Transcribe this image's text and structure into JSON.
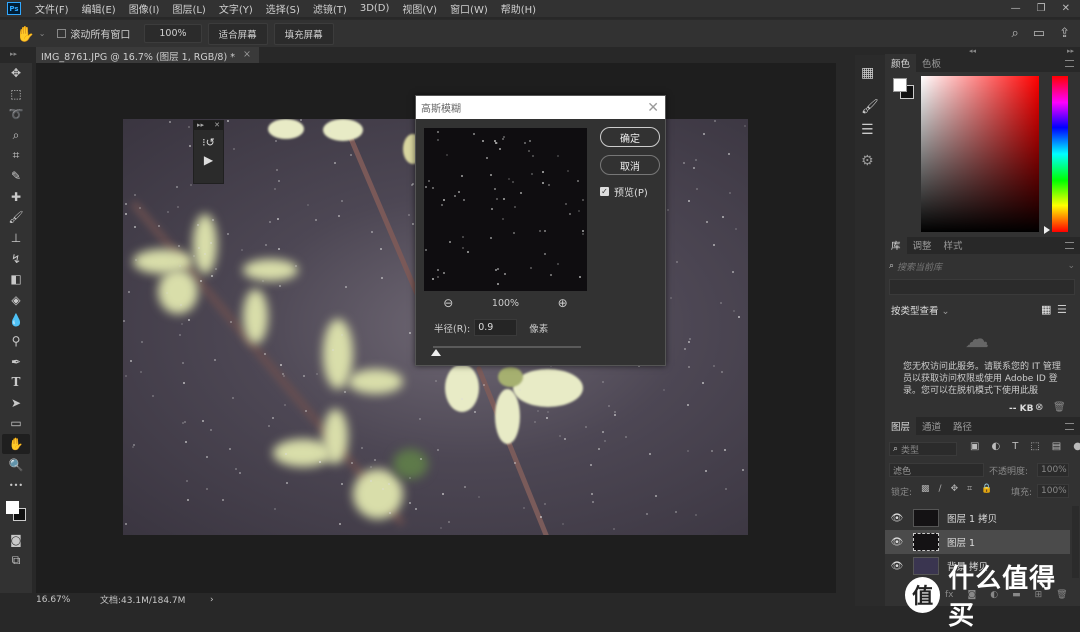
{
  "app": {
    "logo": "Ps"
  },
  "menu": [
    "文件(F)",
    "编辑(E)",
    "图像(I)",
    "图层(L)",
    "文字(Y)",
    "选择(S)",
    "滤镜(T)",
    "3D(D)",
    "视图(V)",
    "窗口(W)",
    "帮助(H)"
  ],
  "window_controls": {
    "minimize": "—",
    "restore": "❐",
    "close": "✕"
  },
  "options_bar": {
    "tool_icon": "hand-icon",
    "scroll_all_label": "滚动所有窗口",
    "scroll_all_checked": false,
    "zoom_value": "100%",
    "fit_screen": "适合屏幕",
    "fill_screen": "填充屏幕"
  },
  "document": {
    "tab_title": "IMG_8761.JPG @ 16.7% (图层 1, RGB/8) *",
    "tab_close": "×"
  },
  "tools": [
    {
      "name": "move",
      "glyph": "✥"
    },
    {
      "name": "marquee",
      "glyph": "⬚"
    },
    {
      "name": "lasso",
      "glyph": "➰"
    },
    {
      "name": "quick-select",
      "glyph": "⌕"
    },
    {
      "name": "crop",
      "glyph": "⌗"
    },
    {
      "name": "eyedropper",
      "glyph": "✎"
    },
    {
      "name": "healing",
      "glyph": "✚"
    },
    {
      "name": "brush",
      "glyph": "🖌"
    },
    {
      "name": "stamp",
      "glyph": "⊥"
    },
    {
      "name": "history-brush",
      "glyph": "↯"
    },
    {
      "name": "eraser",
      "glyph": "◧"
    },
    {
      "name": "paint-bucket",
      "glyph": "◈"
    },
    {
      "name": "blur",
      "glyph": "💧"
    },
    {
      "name": "dodge",
      "glyph": "⚲"
    },
    {
      "name": "pen",
      "glyph": "✒"
    },
    {
      "name": "type",
      "glyph": "T"
    },
    {
      "name": "path-select",
      "glyph": "➤"
    },
    {
      "name": "rectangle",
      "glyph": "▭"
    },
    {
      "name": "hand",
      "glyph": "✋",
      "active": true
    },
    {
      "name": "zoom",
      "glyph": "🔍"
    },
    {
      "name": "more",
      "glyph": "•••"
    }
  ],
  "status": {
    "zoom": "16.67%",
    "doc_info": "文档:43.1M/184.7M",
    "arrow": "›"
  },
  "actions_panel": {
    "play": "▶"
  },
  "gaussian_blur": {
    "title": "高斯模糊",
    "ok": "确定",
    "cancel": "取消",
    "preview_label": "预览(P)",
    "preview_checked": true,
    "preview_zoom": "100%",
    "radius_label": "半径(R):",
    "radius_value": "0.9",
    "radius_unit": "像素",
    "radius_slider_fraction": 0.01
  },
  "color_panel": {
    "tabs": [
      "颜色",
      "色板"
    ],
    "foreground": "#ffffff",
    "background": "#111111",
    "hue_color": "#ff0000"
  },
  "library_panel": {
    "tabs": [
      "库",
      "调整",
      "样式"
    ],
    "search_placeholder": "搜索当前库",
    "view_by": "按类型查看",
    "message": "您无权访问此服务。请联系您的 IT 管理员以获取访问权限或使用 Adobe ID 登录。您可以在脱机模式下使用此服",
    "size": "-- KB"
  },
  "layers_panel": {
    "tabs": [
      "图层",
      "通道",
      "路径"
    ],
    "filter_kind": "类型",
    "blend_mode": "滤色",
    "opacity_label": "不透明度:",
    "opacity": "100%",
    "lock_label": "锁定:",
    "fill_label": "填充:",
    "fill": "100%",
    "layers": [
      {
        "name": "图层 1 拷贝",
        "visible": true,
        "selected": false
      },
      {
        "name": "图层 1",
        "visible": true,
        "selected": true
      },
      {
        "name": "背景 拷贝",
        "visible": true,
        "selected": false
      }
    ],
    "footer_fx": "fx"
  },
  "watermark": {
    "badge": "值",
    "text": "什么值得买"
  }
}
